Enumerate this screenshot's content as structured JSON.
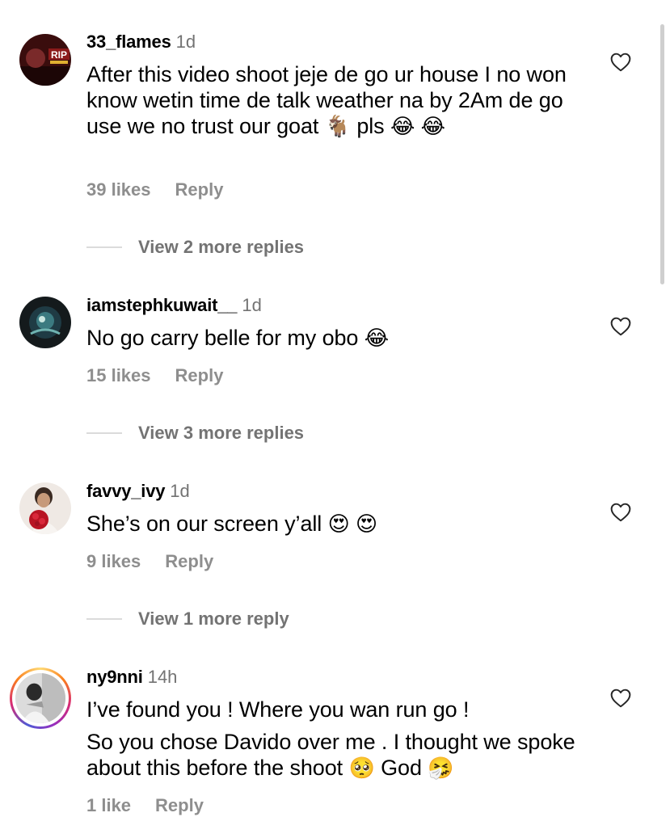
{
  "comments": [
    {
      "username": "33_flames",
      "time": "1d",
      "text_parts": [
        "After this video shoot jeje de go ur house I no won know wetin time de talk weather na by 2Am de go use we no trust our goat ",
        " pls ",
        " "
      ],
      "emojis": [
        "🐐",
        "😂",
        "😂"
      ],
      "likes": "39 likes",
      "reply": "Reply",
      "view_more": "View 2 more replies"
    },
    {
      "username": "iamstephkuwait__",
      "time": "1d",
      "text_parts": [
        "No go carry belle for my obo "
      ],
      "emojis": [
        "😂"
      ],
      "likes": "15 likes",
      "reply": "Reply",
      "view_more": "View 3 more replies"
    },
    {
      "username": "favvy_ivy",
      "time": "1d",
      "text_parts": [
        "She’s on our screen y’all "
      ],
      "emojis": [
        "😍",
        "😍"
      ],
      "likes": "9 likes",
      "reply": "Reply",
      "view_more": "View 1 more reply"
    },
    {
      "username": "ny9nni",
      "time": "14h",
      "line1": "I’ve found you ! Where you wan run go !",
      "line2_parts": [
        "So you chose Davido over me . I thought we spoke about this before the shoot ",
        " God "
      ],
      "emojis": [
        "🥺",
        "🤧"
      ],
      "likes": "1 like",
      "reply": "Reply"
    }
  ],
  "icons": {
    "like": "heart-outline-icon",
    "story_ring": "story-ring-icon"
  },
  "colors": {
    "secondary_text": "#737373",
    "action_text": "#8e8e8e",
    "divider": "#dbdbdb"
  }
}
